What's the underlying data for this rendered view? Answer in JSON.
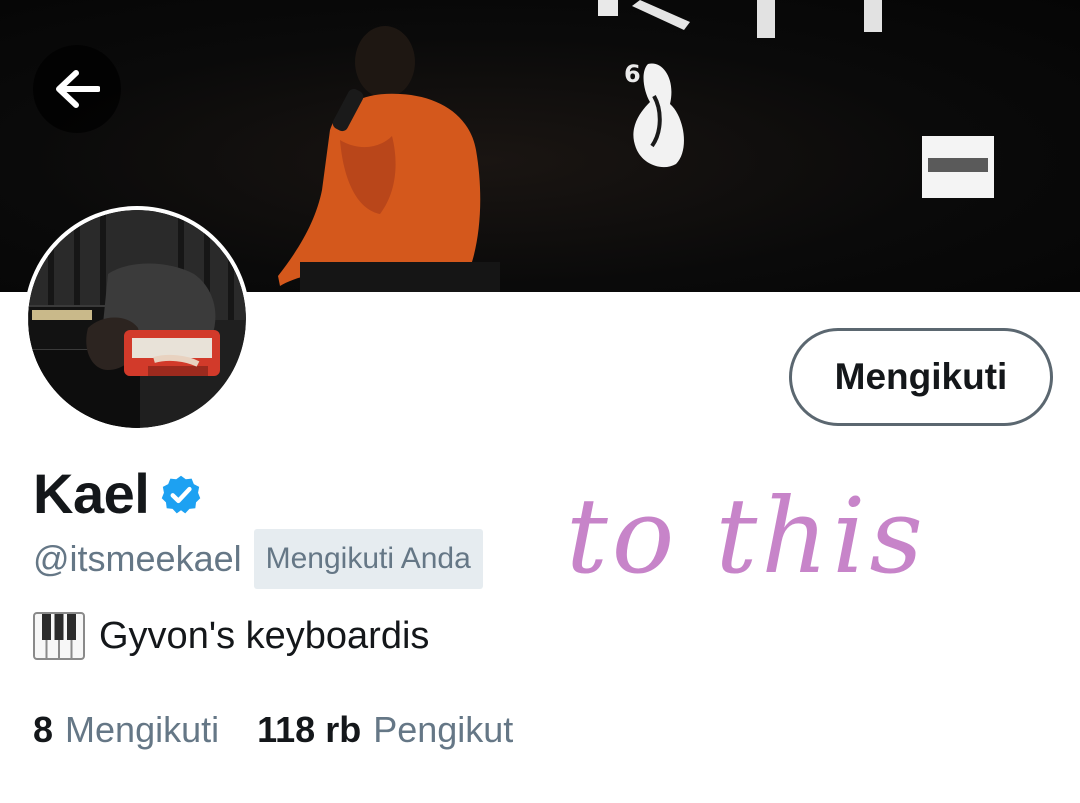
{
  "profile": {
    "display_name": "Kael",
    "handle": "@itsmeekael",
    "follows_you_badge": "Mengikuti Anda",
    "bio": "Gyvon's keyboardis",
    "follow_button_label": "Mengikuti",
    "verified": true
  },
  "stats": {
    "following_count": "8",
    "following_label": "Mengikuti",
    "followers_count": "118 rb",
    "followers_label": "Pengikut"
  },
  "annotation": {
    "text": "to this",
    "color": "#c784c9"
  },
  "icons": {
    "back": "arrow-left-icon",
    "verified": "verified-badge-icon",
    "bio_emoji": "piano-keys-icon"
  },
  "colors": {
    "primary_text": "#14171a",
    "secondary_text": "#657786",
    "verified_blue": "#1da1f2",
    "badge_background": "#e6ecf0",
    "follow_button_border": "#5b6770"
  }
}
